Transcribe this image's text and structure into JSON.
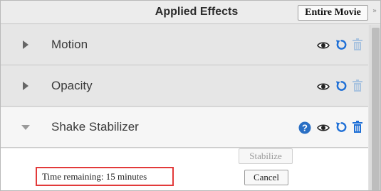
{
  "header": {
    "title": "Applied Effects",
    "scope_button": "Entire Movie",
    "expand_glyph": "»"
  },
  "effects": [
    {
      "name": "Motion",
      "state": "collapsed",
      "icons": [
        "eye-icon",
        "reset-icon",
        "trash-icon"
      ],
      "trash_enabled": false
    },
    {
      "name": "Opacity",
      "state": "collapsed",
      "icons": [
        "eye-icon",
        "reset-icon",
        "trash-icon"
      ],
      "trash_enabled": false
    },
    {
      "name": "Shake Stabilizer",
      "state": "expanded",
      "icons": [
        "help-icon",
        "eye-icon",
        "reset-icon",
        "trash-icon"
      ],
      "trash_enabled": true
    }
  ],
  "stabilizer": {
    "stabilize_label": "Stabilize",
    "stabilize_enabled": false,
    "cancel_label": "Cancel",
    "time_remaining": "Time remaining: 15 minutes"
  },
  "colors": {
    "accent_blue": "#1e6fd6",
    "highlight_red": "#e23a3a",
    "disabled_icon": "#a9c3df"
  }
}
